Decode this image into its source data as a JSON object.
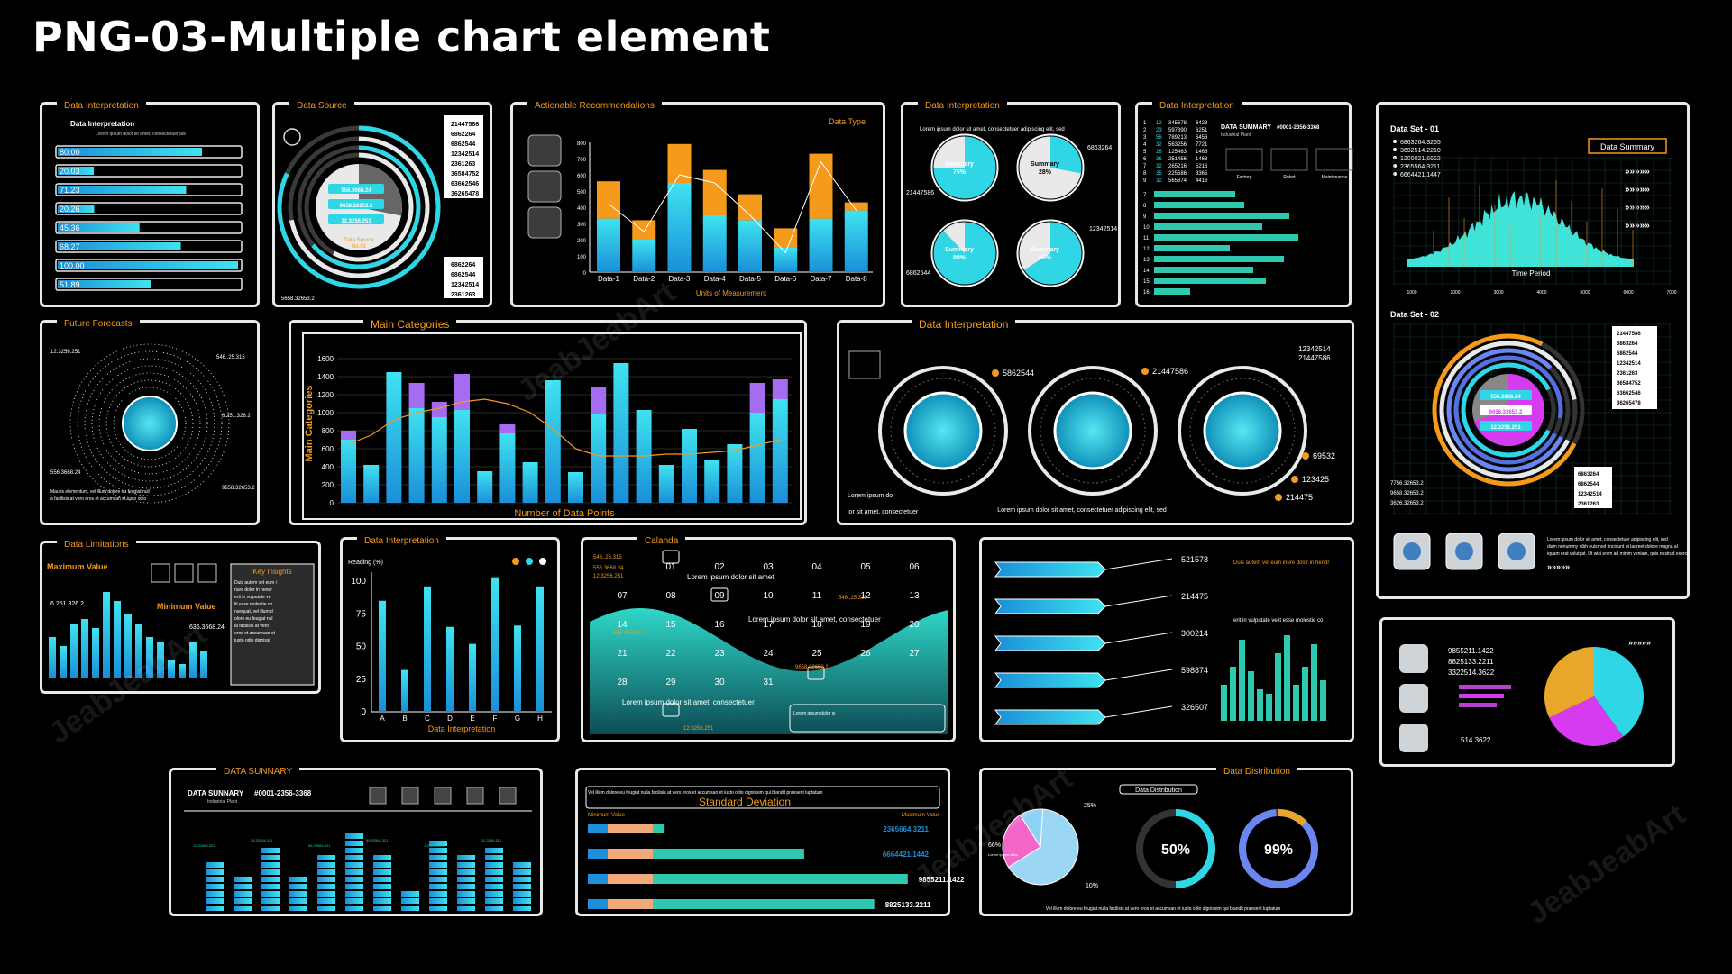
{
  "page": {
    "title": "PNG-03-Multiple chart element",
    "watermark": "JeabJeabArt"
  },
  "colors": {
    "cyan": "#2fd7e6",
    "blue": "#1e8fdc",
    "orange": "#f59a1b",
    "purple": "#a56cf2",
    "magenta": "#d63bef",
    "teal": "#2fc9b0",
    "white": "#e9e9e9"
  },
  "panels": {
    "p1": {
      "header": "Data Interpretation",
      "title": "Data Interpretation",
      "text": "Lorem ipsum dolor sit amet, consectetuer adipiscing elit, sed diam nonummy nibh euismod"
    },
    "p2": {
      "header": "Data Source",
      "center_title": "Data Source",
      "center_sub": "No.01",
      "bottom_value": "5658.32653.2"
    },
    "p3": {
      "header": "Actionable Recommendations",
      "legend": "Data Type"
    },
    "p4": {
      "header": "Data Interpretation",
      "text": "Lorem ipsum dolor sit amet, consectetuer adipiscing elit, sed"
    },
    "p5": {
      "header": "Data Interpretation",
      "summary_title": "DATA SUMMARY",
      "summary_sub": "Industrial Plant",
      "summary_id": "#0001-2356-3368",
      "icons": [
        "Factory",
        "Robot",
        "Maintenance"
      ]
    },
    "p6": {
      "set1_title": "Data Set - 01",
      "set1_summary": "Data Summary",
      "set1_xlabel": "Time Period",
      "set1_arrows": "»»»»»",
      "set2_title": "Data Set - 02",
      "set2_text": "Lorem ipsum dolor sit amet, consectetuer adipiscing elit, sed diam nonummy nibh euismod tincidunt ut laoreet dolore magna aliquam erat volutpat. Ut wisi enim ad minim veniam, quis nostrud exerci",
      "arrows": "»»»»»"
    },
    "p7": {
      "header": "Future Forecasts",
      "text": "Mauris elementum, vel illum dolore eu feugiat nulla facilisis at vero eros et accumsan et iusto odio"
    },
    "p8": {
      "header": "Main Categories"
    },
    "p9": {
      "header": "Data Interpretation",
      "bottom_left": "Lorem ipsum dolor sit amet, consectetuer",
      "bottom_center": "Lorem ipsum dolor sit amet, consectetuer adipiscing elit, sed"
    },
    "p10": {
      "header": "Data Limitations",
      "max_label": "Maximum Value",
      "min_label": "Minimum Value",
      "key_title": "Key Insights",
      "key_text": "Duis autem vel eum iriure dolor in hendrerit in vulputate velit esse molestie consequat, vel illum dolore eu feugiat nulla facilisis at vero eros et accumsan et iusto odio dignissim qui blandit praesent luptatum zzril delenit augue duis dolore te feugait nulla facilisi."
    },
    "p11": {
      "header": "Data Interpretation"
    },
    "p12": {
      "header": "Calanda",
      "note1": "Lorem ipsum dolor sit amet, consectetuer",
      "note2": "Lorem ipsum dolor sit amet, consectetuer",
      "note3": "Lorem ipsum dolor sit amet, consectetuer",
      "note4": "Lorem ipsum dolor sit amet, consectetuer"
    },
    "p13": {
      "text": "Duis autem vel eum iriure dolor in hendrerit in vulputate velit esse molestie consequat, vel illum dolore eu feugiat nulla facilisis at vero eros et accumsan et iusto odio dignissim qui blandit praesent luptatum zzril delenit augue duis dolore te feugait nulla facilisi."
    },
    "p14": {
      "arrows": "»»»»»"
    },
    "p15": {
      "header": "DATA SUNNARY",
      "title": "DATA SUNNARY",
      "sub": "Industrial Plant",
      "id": "#0001-2356-3368"
    },
    "p16": {
      "top_text": "Vel illum dolore eu feugiat nulla facilisis at vero eros et accumsan et iusto odio dignissim qui blandit praesent luptatum",
      "title": "Standard Deviation",
      "min_label": "Minimum Value",
      "max_label": "Maximum Value"
    },
    "p17": {
      "header": "Data Distribution",
      "sub_header": "Data Distribution",
      "bottom_text": "Vel illum dolore eu feugiat nulla facilisis at vero eros et accumsan et iusto odio dignissim qui blandit praesent luptatum",
      "legend_text": "Lorem ipsum dolor sit amet consectetuer"
    }
  },
  "chart_data": [
    {
      "id": "hbars",
      "type": "bar",
      "orientation": "horizontal",
      "categories": [
        "80.00",
        "20.03",
        "71.23",
        "20.26",
        "45.36",
        "68.27",
        "100.00",
        "51.89"
      ],
      "values": [
        80,
        20.03,
        71.23,
        20.26,
        45.36,
        68.27,
        100,
        51.89
      ],
      "xlim": [
        0,
        100
      ]
    },
    {
      "id": "donut_source",
      "type": "pie",
      "rings": [
        0.82,
        0.72,
        0.64,
        0.58
      ],
      "center_values": [
        "556.3668.24",
        "9658.32653.2",
        "12.3256.251"
      ],
      "labels_right_top": [
        "21447586",
        "6862264",
        "6862544",
        "12342514",
        "2361263",
        "36584752",
        "63662546",
        "36265478"
      ],
      "labels_right_bottom": [
        "6862264",
        "6862544",
        "12342514",
        "2361263"
      ]
    },
    {
      "id": "stacked_types",
      "type": "bar",
      "categories": [
        "Data-1",
        "Data-2",
        "Data-3",
        "Data-4",
        "Data-5",
        "Data-6",
        "Data-7",
        "Data-8"
      ],
      "series": [
        {
          "name": "base",
          "values": [
            330,
            200,
            550,
            350,
            320,
            150,
            330,
            380
          ]
        },
        {
          "name": "top",
          "values": [
            230,
            120,
            240,
            280,
            160,
            120,
            400,
            50
          ]
        }
      ],
      "line": [
        420,
        250,
        600,
        550,
        350,
        120,
        680,
        380
      ],
      "ylim": [
        0,
        800
      ],
      "xlabel": "Units of Measurement",
      "legend": "Data Type"
    },
    {
      "id": "pies_summary",
      "type": "pie",
      "slices": [
        {
          "label": "Summary",
          "value": 75,
          "display": "75%"
        },
        {
          "label": "Summary",
          "value": 28,
          "display": "28%"
        },
        {
          "label": "Summary",
          "value": 88,
          "display": "88%"
        },
        {
          "label": "Summary",
          "value": 66,
          "display": "66%"
        }
      ],
      "tags": [
        "6863264",
        "21447586",
        "12342514",
        "6862544"
      ]
    },
    {
      "id": "summary_table",
      "type": "table",
      "rows": [
        [
          "1",
          "12",
          "345678",
          "6428"
        ],
        [
          "2",
          "23",
          "597890",
          "6251"
        ],
        [
          "3",
          "56",
          "789213",
          "6456"
        ],
        [
          "4",
          "32",
          "563256",
          "7721"
        ],
        [
          "5",
          "26",
          "125463",
          "1463"
        ],
        [
          "6",
          "36",
          "251456",
          "1463"
        ],
        [
          "7",
          "32",
          "265216",
          "5216"
        ],
        [
          "8",
          "35",
          "225586",
          "3365"
        ],
        [
          "9",
          "32",
          "565874",
          "4416"
        ]
      ],
      "bars": [
        0.45,
        0.5,
        0.75,
        0.6,
        0.8,
        0.42,
        0.72,
        0.55,
        0.62,
        0.2
      ],
      "bar_rows": [
        "7",
        "8",
        "9",
        "10",
        "11",
        "12",
        "13",
        "14",
        "15",
        "16"
      ]
    },
    {
      "id": "timeseries",
      "type": "area",
      "x_ticks": [
        "1000",
        "2000",
        "3000",
        "4000",
        "5000",
        "6000",
        "7000"
      ],
      "xlabel": "Time Period",
      "list": [
        "6863264.3265",
        "3692514.2210",
        "1200021.6652",
        "2365564.3211",
        "6664421.1447"
      ]
    },
    {
      "id": "donut_set2",
      "type": "pie",
      "center_values": [
        "556.3668.24",
        "9658.32653.2",
        "12.3256.251"
      ],
      "labels_right": [
        "21447586",
        "6863264",
        "6862544",
        "12342514",
        "2361263",
        "36584752",
        "63662546",
        "36265478"
      ],
      "labels_bottom": [
        "6863264",
        "6862544",
        "12342514",
        "2361263"
      ],
      "left_values": [
        "7756.32653.2",
        "9658.32653.2",
        "3626.32653.2"
      ]
    },
    {
      "id": "forecast",
      "type": "scatter",
      "labels": [
        "12.3256.251",
        "546..25.315",
        "6.251.326.2",
        "556.3668.24",
        "9658.32653.2"
      ]
    },
    {
      "id": "main_categories",
      "type": "bar",
      "categories": [
        "1",
        "2",
        "3",
        "4",
        "5",
        "6",
        "7",
        "8",
        "9",
        "10",
        "11",
        "12",
        "13",
        "14",
        "15",
        "16",
        "17",
        "18",
        "19",
        "20"
      ],
      "series": [
        {
          "name": "base",
          "values": [
            700,
            420,
            1450,
            1050,
            950,
            1030,
            350,
            770,
            450,
            1360,
            340,
            980,
            1550,
            1030,
            420,
            820,
            470,
            650,
            1000,
            1150
          ]
        },
        {
          "name": "top",
          "values": [
            100,
            0,
            0,
            280,
            170,
            400,
            0,
            100,
            0,
            0,
            0,
            300,
            0,
            0,
            0,
            0,
            0,
            0,
            330,
            220
          ]
        }
      ],
      "line": [
        650,
        750,
        920,
        1000,
        1050,
        1120,
        1150,
        1100,
        1000,
        820,
        600,
        520,
        520,
        520,
        540,
        540,
        560,
        580,
        640,
        700
      ],
      "ylim": [
        0,
        1600
      ],
      "y_ticks": [
        0,
        200,
        400,
        600,
        800,
        1000,
        1200,
        1400,
        1600
      ],
      "xlabel": "Number of Data Points",
      "ylabel": "Main Categories"
    },
    {
      "id": "rings",
      "type": "pie",
      "labels": [
        "5862544",
        "21447586",
        "12342514",
        "21447586",
        "69532",
        "123425",
        "214475"
      ]
    },
    {
      "id": "limitations",
      "type": "bar",
      "values": [
        45,
        35,
        60,
        65,
        55,
        95,
        85,
        70,
        60,
        45,
        40,
        20,
        15,
        40,
        30
      ],
      "labels": [
        "6.251.326.2",
        "636.3668.24"
      ]
    },
    {
      "id": "reading",
      "type": "bar",
      "categories": [
        "A",
        "B",
        "C",
        "D",
        "E",
        "F",
        "G",
        "H"
      ],
      "values": [
        85,
        32,
        96,
        65,
        52,
        103,
        66,
        96
      ],
      "ylim": [
        0,
        100
      ],
      "y_ticks": [
        0,
        25,
        50,
        75,
        100
      ],
      "ylabel": "Reading (%)",
      "xlabel": "Data Interpretation"
    },
    {
      "id": "calendar",
      "type": "area",
      "days": [
        "01",
        "02",
        "03",
        "04",
        "05",
        "06",
        "07",
        "08",
        "09",
        "10",
        "11",
        "12",
        "13",
        "14",
        "15",
        "16",
        "17",
        "18",
        "19",
        "20",
        "21",
        "22",
        "23",
        "24",
        "25",
        "26",
        "27",
        "28",
        "29",
        "30",
        "31"
      ],
      "labels": [
        "546..25.315",
        "556.3668.24",
        "12.3256.251",
        "546..25.315",
        "556.3668.24",
        "9658.32653.2",
        "12.3256.251"
      ]
    },
    {
      "id": "arrow_bars",
      "type": "bar",
      "orientation": "horizontal",
      "values": [
        521578,
        214475,
        300214,
        598874,
        326507
      ],
      "display": [
        "521578",
        "214475",
        "300214",
        "598874",
        "326507"
      ],
      "mini": [
        40,
        60,
        90,
        55,
        35,
        30,
        75,
        95,
        40,
        60,
        85,
        45
      ]
    },
    {
      "id": "pie_panel",
      "type": "pie",
      "values": [
        40,
        28,
        32
      ],
      "labels": [
        "9855211.1422",
        "8825133.2211",
        "3322514.3622",
        "514.3622"
      ]
    },
    {
      "id": "equalizer",
      "type": "bar",
      "values": [
        7,
        5,
        9,
        5,
        8,
        11,
        8,
        3,
        10,
        8,
        9,
        7
      ],
      "labels": [
        "12.32564.321",
        "36.32564.321",
        "65.32564.321",
        "99.32564.321",
        "1.2563.6625",
        "12.3256.521"
      ]
    },
    {
      "id": "std_dev",
      "type": "bar",
      "orientation": "horizontal",
      "values": [
        2365664.3211,
        6664421.1442,
        9855211.1422,
        8825133.2211
      ],
      "display": [
        "2365664.3211",
        "6664421.1442",
        "9855211.1422",
        "8825133.2211"
      ]
    },
    {
      "id": "distribution",
      "type": "pie",
      "slices": [
        {
          "value": 66,
          "display": "66%"
        },
        {
          "value": 25,
          "display": "25%"
        },
        {
          "value": 10,
          "display": "10%"
        }
      ],
      "gauges": [
        {
          "value": 50,
          "display": "50%"
        },
        {
          "value": 99,
          "display": "99%"
        }
      ]
    }
  ]
}
